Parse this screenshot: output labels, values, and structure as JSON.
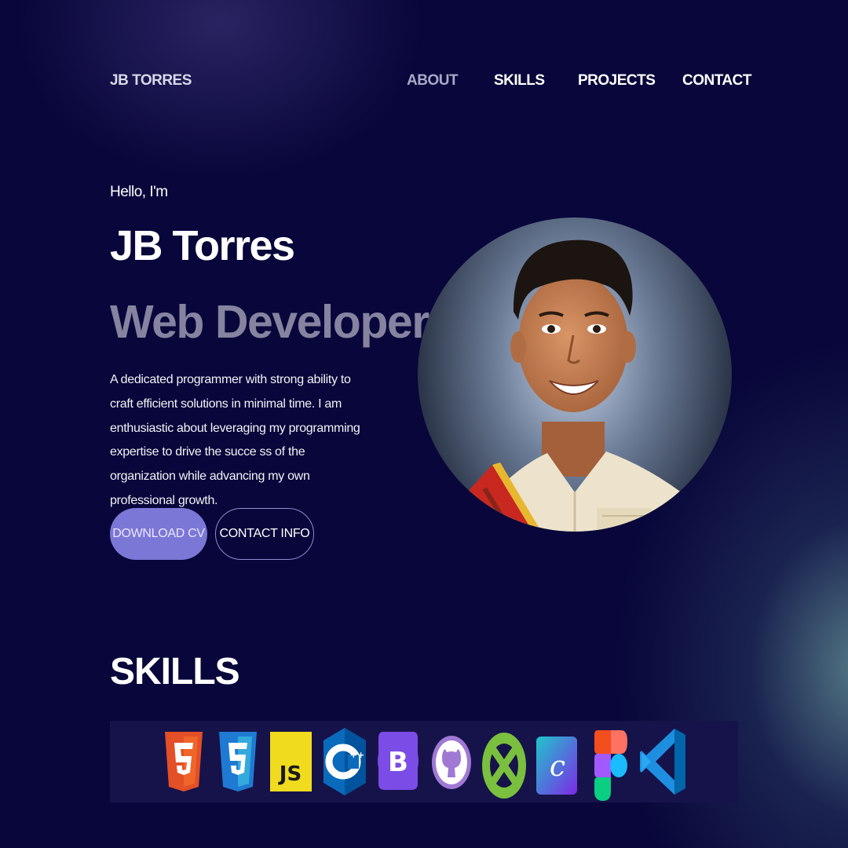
{
  "nav": {
    "brand": "JB TORRES",
    "links": [
      {
        "label": "ABOUT",
        "active": true
      },
      {
        "label": "SKILLS",
        "active": false
      },
      {
        "label": "PROJECTS",
        "active": false
      },
      {
        "label": "CONTACT",
        "active": false
      }
    ]
  },
  "hero": {
    "greeting": "Hello, I'm",
    "name": "JB Torres",
    "role": "Web Developer",
    "bio": "A dedicated programmer with strong ability to craft efficient solutions in minimal time. I am enthusiastic about leveraging my programming expertise to drive the succe ss of the organization while advancing my own professional growth.",
    "buttons": {
      "download_cv": "DOWNLOAD CV",
      "contact_info": "CONTACT INFO"
    },
    "photo_icon": "profile-photo"
  },
  "skills": {
    "title": "SKILLS",
    "icons": [
      {
        "name": "html5-icon",
        "color": "#e34f26"
      },
      {
        "name": "css3-icon",
        "color": "#1f7ad3"
      },
      {
        "name": "javascript-icon",
        "color": "#f0db1e"
      },
      {
        "name": "cplusplus-icon",
        "color": "#0a6bbd"
      },
      {
        "name": "bootstrap-icon",
        "color": "#7c4ce6"
      },
      {
        "name": "github-icon",
        "color": "#a079d4"
      },
      {
        "name": "xampp-icon",
        "color": "#7bbf3e"
      },
      {
        "name": "canva-icon",
        "color": "#2ea8d8"
      },
      {
        "name": "figma-icon",
        "color": "#f24e1e"
      },
      {
        "name": "vscode-icon",
        "color": "#1e8fe0"
      }
    ]
  },
  "colors": {
    "background": "#08063a",
    "accent": "#7b77d6",
    "role_text": "#85839f",
    "skills_bar": "#16134a"
  }
}
